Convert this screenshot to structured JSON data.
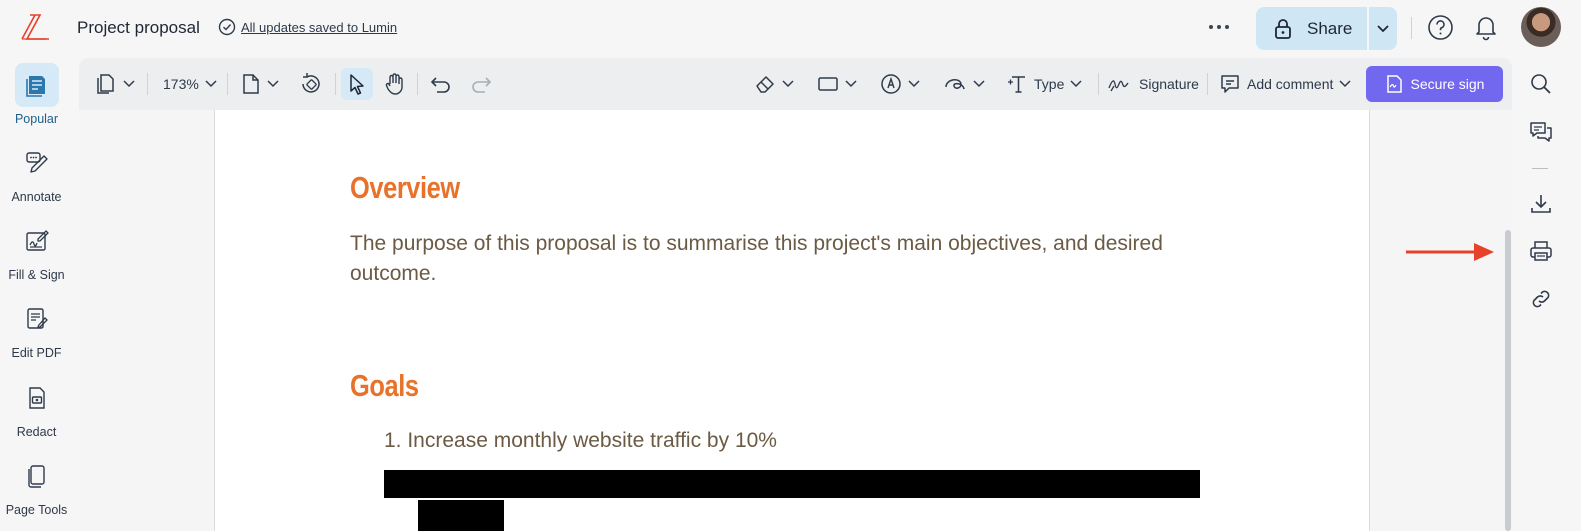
{
  "header": {
    "title": "Project proposal",
    "save_status": "All updates saved to Lumin",
    "share_label": "Share",
    "icons": [
      "lumin-logo",
      "check-circle-icon",
      "more-icon",
      "lock-icon",
      "chevron-down-icon",
      "help-icon",
      "bell-icon",
      "avatar"
    ]
  },
  "left_sidebar": {
    "items": [
      {
        "label": "Popular",
        "icon": "popular-icon",
        "active": true
      },
      {
        "label": "Annotate",
        "icon": "annotate-icon"
      },
      {
        "label": "Fill & Sign",
        "icon": "fill-sign-icon"
      },
      {
        "label": "Edit PDF",
        "icon": "edit-pdf-icon"
      },
      {
        "label": "Redact",
        "icon": "redact-icon"
      },
      {
        "label": "Page Tools",
        "icon": "page-tools-icon"
      }
    ]
  },
  "toolbar": {
    "zoom": "173%",
    "type_label": "Type",
    "signature_label": "Signature",
    "add_comment_label": "Add comment",
    "secure_sign_label": "Secure sign",
    "active_tool": "select"
  },
  "document": {
    "heading_overview": "Overview",
    "overview_text": "The purpose of this proposal is to summarise this project's main objectives, and desired outcome.",
    "heading_goals": "Goals",
    "goal_1": "1. Increase monthly website traffic by 10%"
  },
  "right_rail": {
    "icons": [
      "search-icon",
      "comments-icon",
      "download-icon",
      "print-icon",
      "link-icon"
    ]
  },
  "colors": {
    "accent": "#7267ef",
    "heading": "#e8722a",
    "body_text": "#6b5a44",
    "share_bg": "#cfe7f5",
    "annotation_arrow": "#e8412a"
  }
}
